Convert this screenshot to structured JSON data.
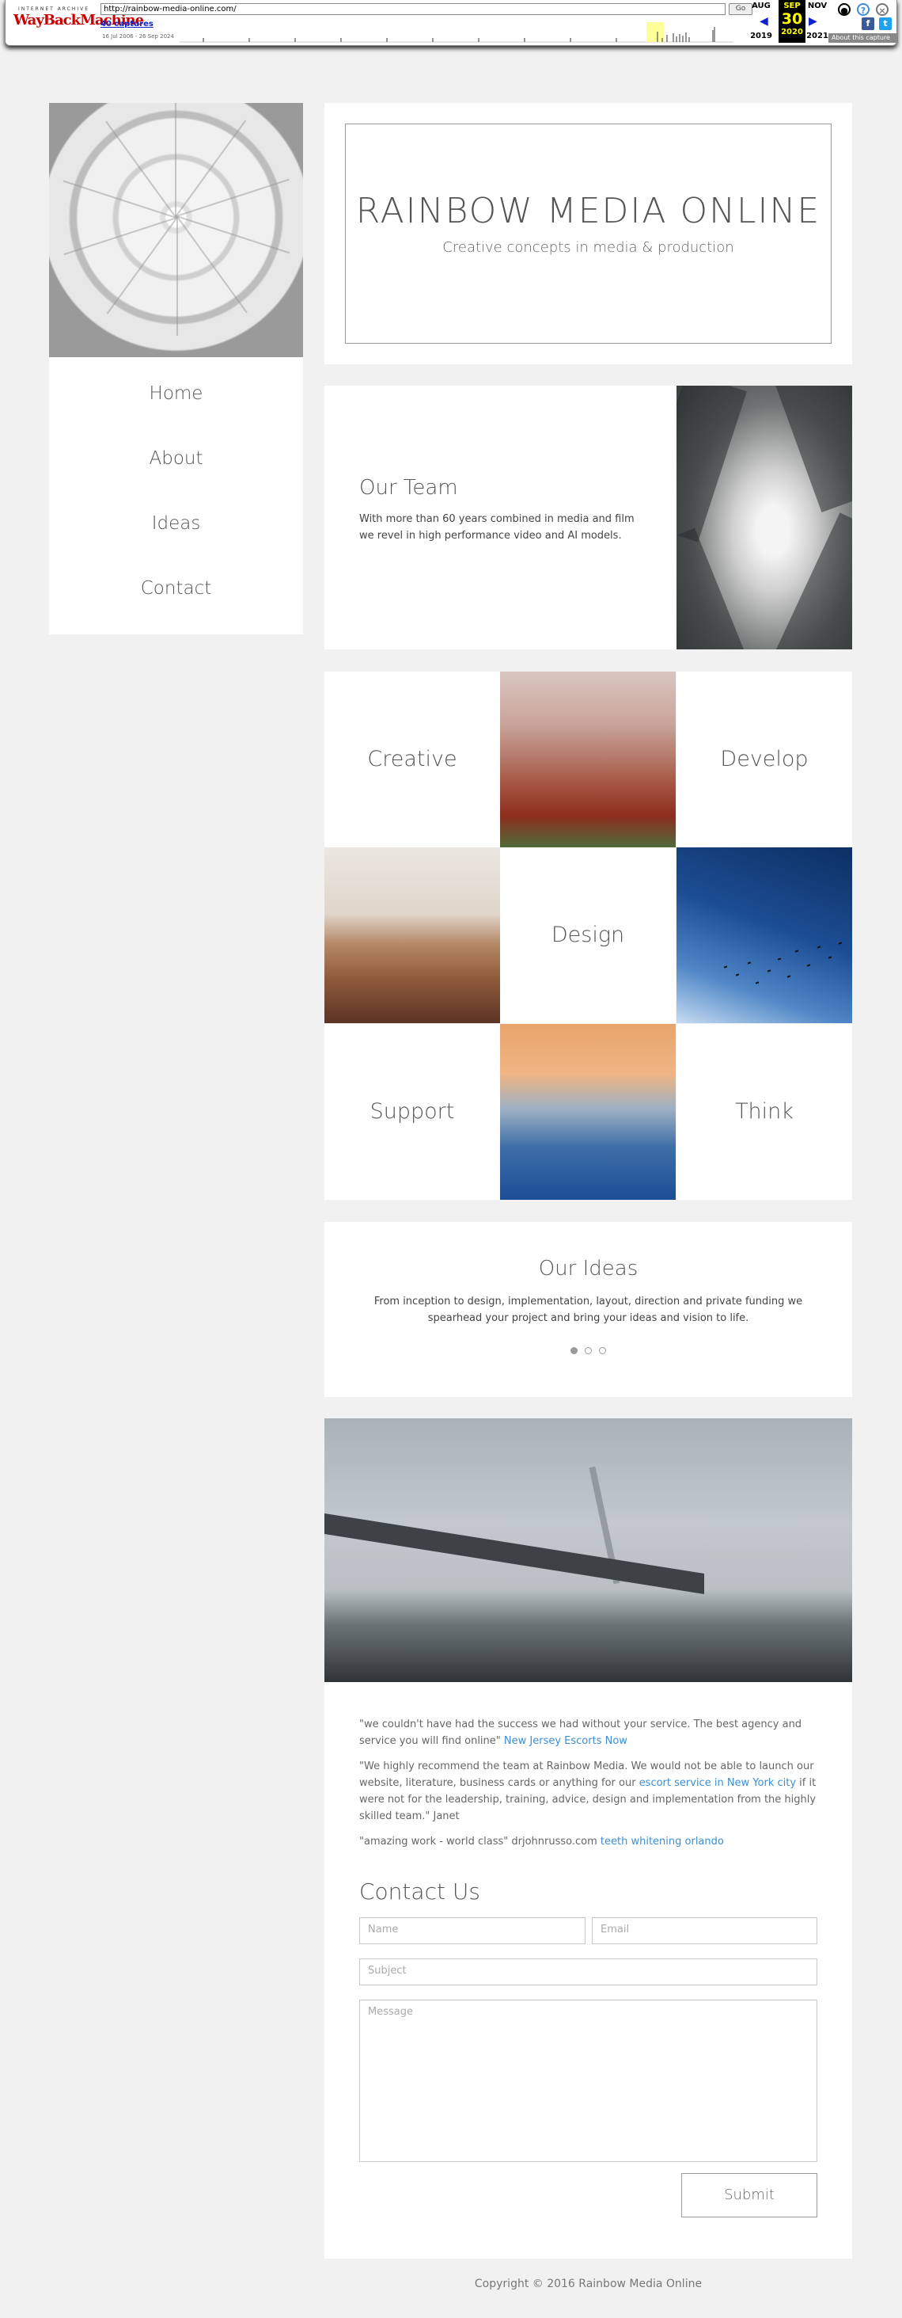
{
  "wayback": {
    "logo_top": "INTERNET ARCHIVE",
    "logo_main": "WayBackMachine",
    "url": "http://rainbow-media-online.com/",
    "go_label": "Go",
    "captures": "40 captures",
    "range": "16 Jul 2006 - 26 Sep 2024",
    "prev_month": "AUG",
    "cur_month": "SEP",
    "next_month": "NOV",
    "prev_year": "2019",
    "cur_day": "30",
    "cur_year": "2020",
    "next_year": "2021",
    "about": "About this capture"
  },
  "nav": {
    "items": [
      "Home",
      "About",
      "Ideas",
      "Contact"
    ]
  },
  "header": {
    "title": "RAINBOW MEDIA ONLINE",
    "subtitle": "Creative concepts in media & production"
  },
  "team": {
    "title": "Our Team",
    "body": "With more than 60 years combined in media and film we revel in high performance video and AI models."
  },
  "grid": {
    "creative": "Creative",
    "develop": "Develop",
    "design": "Design",
    "support": "Support",
    "think": "Think"
  },
  "ideas": {
    "title": "Our Ideas",
    "body": "From inception to design, implementation, layout, direction and private funding we spearhead your project and bring your ideas and vision to life."
  },
  "testimonials": [
    {
      "text": "\"we couldn't have had the success we had without your service. The best agency and service you will find online\"",
      "link": "New Jersey Escorts Now",
      "after": ""
    },
    {
      "text": "\"We highly recommend the team at Rainbow Media. We would not be able to launch our website, literature, business cards or anything for our",
      "link": "escort service in New York city",
      "after": "if it were not for the leadership, training, advice, design and implementation from the highly skilled team.\" Janet"
    },
    {
      "text": "\"amazing work - world class\" drjohnrusso.com",
      "link": "teeth whitening orlando",
      "after": ""
    }
  ],
  "contact": {
    "title": "Contact Us",
    "name_placeholder": "Name",
    "email_placeholder": "Email",
    "subject_placeholder": "Subject",
    "message_placeholder": "Message",
    "submit_label": "Submit"
  },
  "footer": {
    "copyright": "Copyright © 2016 Rainbow Media Online"
  }
}
